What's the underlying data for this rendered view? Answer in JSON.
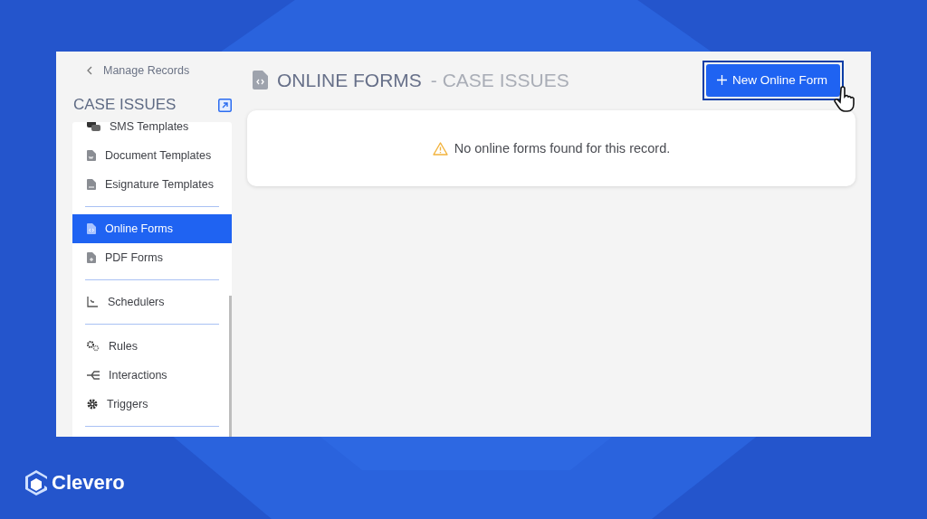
{
  "sidebar": {
    "back_link": "Manage Records",
    "title": "CASE ISSUES",
    "groups": [
      {
        "items": [
          {
            "label": "SMS Templates",
            "selected": false
          },
          {
            "label": "Document Templates",
            "selected": false
          },
          {
            "label": "Esignature Templates",
            "selected": false
          }
        ]
      },
      {
        "items": [
          {
            "label": "Online Forms",
            "selected": true
          },
          {
            "label": "PDF Forms",
            "selected": false
          }
        ]
      },
      {
        "items": [
          {
            "label": "Schedulers",
            "selected": false
          }
        ]
      },
      {
        "items": [
          {
            "label": "Rules",
            "selected": false
          },
          {
            "label": "Interactions",
            "selected": false
          },
          {
            "label": "Triggers",
            "selected": false
          }
        ]
      }
    ]
  },
  "header": {
    "title": "ONLINE FORMS",
    "subtitle": "- CASE ISSUES"
  },
  "new_button": {
    "label": "New Online Form"
  },
  "empty_message": "No online forms found for this record.",
  "brand": "Clevero"
}
